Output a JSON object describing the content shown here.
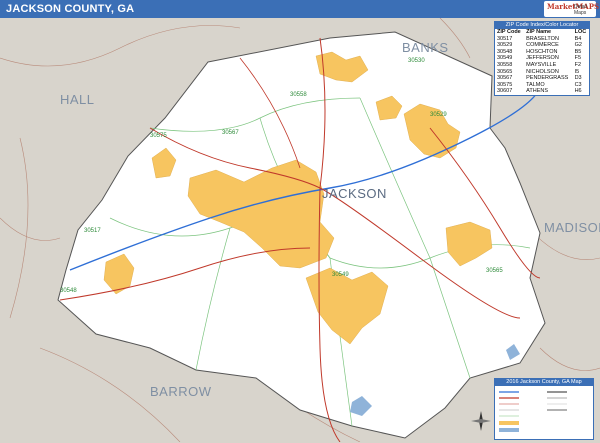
{
  "header": {
    "title": "JACKSON COUNTY, GA",
    "logo_text": "MarketMAPS",
    "logo_sub": "Detail Maps"
  },
  "map": {
    "county_name": "JACKSON",
    "neighbor_labels": {
      "north": "BANKS",
      "west": "HALL",
      "east": "MADISON",
      "south": "BARROW"
    },
    "zip_labels": [
      "30558",
      "30567",
      "30575",
      "30565",
      "30517",
      "30548",
      "30529",
      "30549",
      "30530",
      "30607"
    ],
    "colors": {
      "county_fill": "#ffffff",
      "outside_fill": "#d8d4cc",
      "urban": "#f7c560",
      "road_major": "#c0392b",
      "road_interstate": "#2f6fd6",
      "zip_boundary": "#7cc47f",
      "water": "#8fb3d9"
    }
  },
  "legend": {
    "title": "ZIP Code Index/Color Locator",
    "columns": [
      "ZIP Code",
      "ZIP Name",
      "LOC"
    ],
    "rows": [
      [
        "30517",
        "BRASELTON",
        "B4"
      ],
      [
        "30529",
        "COMMERCE",
        "G2"
      ],
      [
        "30548",
        "HOSCHTON",
        "B5"
      ],
      [
        "30549",
        "JEFFERSON",
        "F5"
      ],
      [
        "30558",
        "MAYSVILLE",
        "F2"
      ],
      [
        "30565",
        "NICHOLSON",
        "I5"
      ],
      [
        "30567",
        "PENDERGRASS",
        "D3"
      ],
      [
        "30575",
        "TALMO",
        "C3"
      ],
      [
        "30607",
        "ATHENS",
        "H6"
      ]
    ]
  },
  "infobox": {
    "title": "2016 Jackson County, GA Map"
  }
}
